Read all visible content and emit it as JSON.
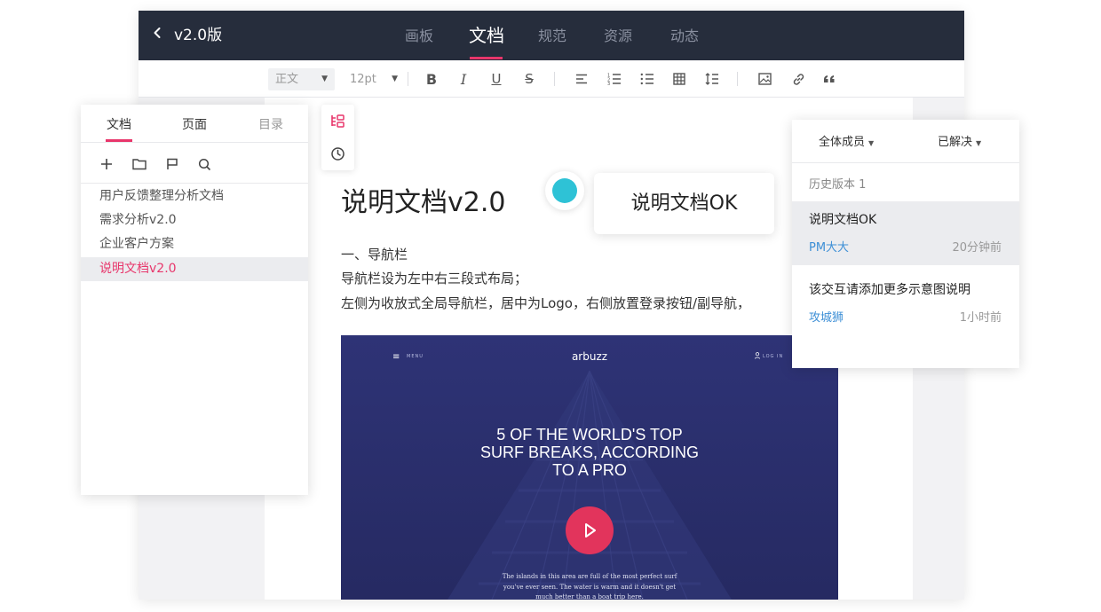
{
  "header": {
    "back_icon": "chevron-left-icon",
    "version": "v2.0版",
    "tabs": [
      {
        "label": "画板",
        "active": false
      },
      {
        "label": "文档",
        "active": true
      },
      {
        "label": "规范",
        "active": false
      },
      {
        "label": "资源",
        "active": false
      },
      {
        "label": "动态",
        "active": false
      }
    ]
  },
  "toolbar": {
    "style_select": "正文",
    "size_select": "12pt",
    "icons": [
      "bold-icon",
      "italic-icon",
      "underline-icon",
      "strikethrough-icon",
      "align-icon",
      "ordered-list-icon",
      "bullet-list-icon",
      "table-icon",
      "line-spacing-icon",
      "image-icon",
      "link-icon",
      "quote-icon"
    ]
  },
  "left_panel": {
    "tabs": [
      "文档",
      "页面",
      "目录"
    ],
    "active_tab": "文档",
    "actions": [
      "add-icon",
      "folder-icon",
      "flag-icon",
      "search-icon"
    ],
    "items": [
      {
        "label": "用户反馈整理分析文档",
        "selected": false
      },
      {
        "label": "需求分析v2.0",
        "selected": false
      },
      {
        "label": "企业客户方案",
        "selected": false
      },
      {
        "label": "说明文档v2.0",
        "selected": true
      }
    ]
  },
  "side_tools": [
    "outline-icon",
    "history-icon"
  ],
  "document": {
    "title": "说明文档v2.0",
    "paragraphs": [
      "一、导航栏",
      "导航栏设为左中右三段式布局；",
      "左侧为收放式全局导航栏，居中为Logo，右侧放置登录按钮/副导航，"
    ],
    "embed": {
      "menu_label": "MENU",
      "brand": "arbuzz",
      "login_label": "LOG IN",
      "headline": [
        "5 OF THE WORLD'S TOP",
        "SURF BREAKS, ACCORDING",
        "TO A PRO"
      ],
      "caption": [
        "The islands in this area are full of the most perfect surf",
        "you've ever seen. The water is warm and it doesn't get",
        "much better than a boat trip here."
      ]
    }
  },
  "comment_bubble": {
    "text": "说明文档OK",
    "dot_color": "#2ec2d6"
  },
  "right_panel": {
    "filters": [
      "全体成员",
      "已解决"
    ],
    "section_label": "历史版本 1",
    "comments": [
      {
        "title": "说明文档OK",
        "author": "PM大大",
        "time": "20分钟前",
        "selected": true
      },
      {
        "title": "该交互请添加更多示意图说明",
        "author": "攻城狮",
        "time": "1小时前",
        "selected": false
      }
    ]
  },
  "colors": {
    "topbar": "#262d3c",
    "accent": "#e8366b",
    "link": "#3d8fd6",
    "hero_bg": "#2b3070",
    "play": "#e2345c"
  }
}
